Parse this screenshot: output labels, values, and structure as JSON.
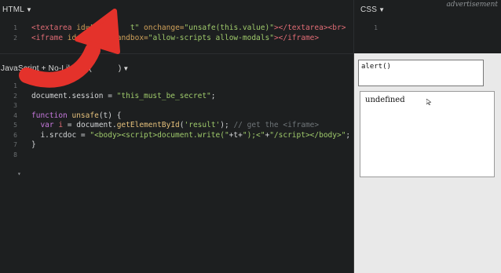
{
  "html_pane": {
    "label": "HTML",
    "line_numbers": [
      "1",
      "2"
    ],
    "lines": [
      [
        {
          "t": "<textarea ",
          "c": "tag"
        },
        {
          "t": "id=",
          "c": "attr"
        },
        {
          "t": "\"se",
          "c": "str"
        },
        {
          "t": "      ",
          "c": "plain"
        },
        {
          "t": "t\" ",
          "c": "str"
        },
        {
          "t": "onchange=",
          "c": "attr"
        },
        {
          "t": "\"unsafe(this.value)\"",
          "c": "str"
        },
        {
          "t": "></textarea><br>",
          "c": "tag"
        }
      ],
      [
        {
          "t": "<iframe ",
          "c": "tag"
        },
        {
          "t": "id=",
          "c": "attr"
        },
        {
          "t": "\"",
          "c": "str"
        },
        {
          "t": "      ",
          "c": "plain"
        },
        {
          "t": "sandbox=",
          "c": "attr"
        },
        {
          "t": "\"allow-scripts allow-modals\"",
          "c": "str"
        },
        {
          "t": "></iframe>",
          "c": "tag"
        }
      ]
    ]
  },
  "css_pane": {
    "label": "CSS",
    "line_numbers": [
      "1"
    ]
  },
  "js_pane": {
    "label": "JavaScript + No-Library (",
    "label_suffix": ")",
    "line_numbers": [
      "1",
      "2",
      "3",
      "4",
      "5",
      "6",
      "7",
      "8"
    ],
    "lines": [
      [],
      [
        {
          "t": "document.session = ",
          "c": "plain"
        },
        {
          "t": "\"this_must_be_secret\"",
          "c": "str"
        },
        {
          "t": ";",
          "c": "plain"
        }
      ],
      [],
      [
        {
          "t": "function ",
          "c": "kw"
        },
        {
          "t": "unsafe",
          "c": "fn"
        },
        {
          "t": "(t) {",
          "c": "plain"
        }
      ],
      [
        {
          "t": "  var ",
          "c": "kw"
        },
        {
          "t": "i",
          "c": "var"
        },
        {
          "t": " = document.",
          "c": "plain"
        },
        {
          "t": "getElementById",
          "c": "fn"
        },
        {
          "t": "(",
          "c": "plain"
        },
        {
          "t": "'result'",
          "c": "str"
        },
        {
          "t": "); ",
          "c": "plain"
        },
        {
          "t": "// get the <iframe>",
          "c": "cm"
        }
      ],
      [
        {
          "t": "  i.srcdoc = ",
          "c": "plain"
        },
        {
          "t": "\"<body><script>document.write(\"",
          "c": "str"
        },
        {
          "t": "+t+",
          "c": "plain"
        },
        {
          "t": "\");<\"",
          "c": "str"
        },
        {
          "t": "+",
          "c": "plain"
        },
        {
          "t": "\"/script></body>\"",
          "c": "str"
        },
        {
          "t": ";",
          "c": "plain"
        }
      ],
      [
        {
          "t": "}",
          "c": "plain"
        }
      ],
      []
    ]
  },
  "watermark": "advertisement",
  "result": {
    "textarea_value": "alert()",
    "iframe_text": "undefined"
  },
  "colors": {
    "background": "#1d1f20",
    "arrow": "#e4322b"
  }
}
